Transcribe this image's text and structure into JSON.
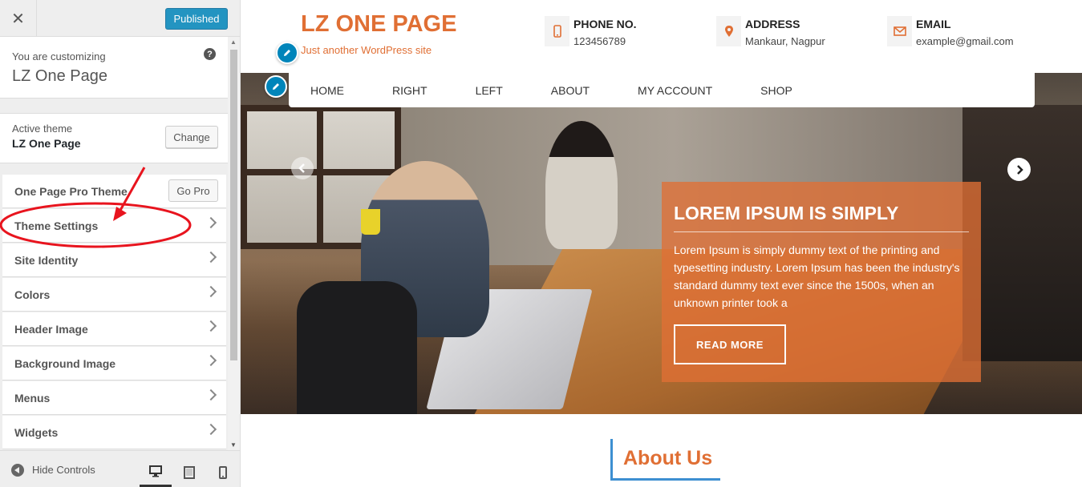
{
  "sidebar": {
    "close_icon": "close-icon",
    "published_label": "Published",
    "customizing_label": "You are customizing",
    "customizing_title": "LZ One Page",
    "help_icon": "?",
    "active_theme_label": "Active theme",
    "active_theme_name": "LZ One Page",
    "change_label": "Change",
    "pro_label": "One Page Pro Theme",
    "gopro_label": "Go Pro",
    "sections": [
      {
        "label": "Theme Settings"
      },
      {
        "label": "Site Identity"
      },
      {
        "label": "Colors"
      },
      {
        "label": "Header Image"
      },
      {
        "label": "Background Image"
      },
      {
        "label": "Menus"
      },
      {
        "label": "Widgets"
      }
    ],
    "hide_controls_label": "Hide Controls"
  },
  "preview": {
    "site_title": "LZ ONE PAGE",
    "site_tagline": "Just another WordPress site",
    "contacts": [
      {
        "title": "PHONE NO.",
        "value": "123456789",
        "icon": "phone-icon"
      },
      {
        "title": "ADDRESS",
        "value": "Mankaur, Nagpur",
        "icon": "location-icon"
      },
      {
        "title": "EMAIL",
        "value": "example@gmail.com",
        "icon": "mail-icon"
      }
    ],
    "nav": [
      "HOME",
      "RIGHT",
      "LEFT",
      "ABOUT",
      "MY ACCOUNT",
      "SHOP"
    ],
    "slide": {
      "title": "LOREM IPSUM IS SIMPLY",
      "text": "Lorem Ipsum is simply dummy text of the printing and typesetting industry. Lorem Ipsum has been the industry's standard dummy text ever since the 1500s, when an unknown printer took a",
      "button": "READ MORE"
    },
    "about_heading": "About Us"
  },
  "colors": {
    "accent": "#e06f34",
    "wp_blue": "#0085ba",
    "annotation_red": "#e8141e",
    "about_border": "#3d8fd1"
  }
}
